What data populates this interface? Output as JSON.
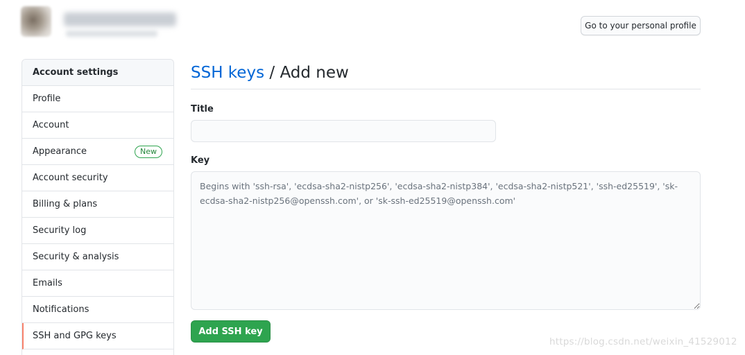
{
  "header": {
    "user_name": "",
    "user_subtitle": "",
    "profile_button_label": "Go to your personal profile"
  },
  "sidebar": {
    "heading": "Account settings",
    "items": [
      {
        "label": "Profile"
      },
      {
        "label": "Account"
      },
      {
        "label": "Appearance",
        "badge": "New"
      },
      {
        "label": "Account security"
      },
      {
        "label": "Billing & plans"
      },
      {
        "label": "Security log"
      },
      {
        "label": "Security & analysis"
      },
      {
        "label": "Emails"
      },
      {
        "label": "Notifications"
      },
      {
        "label": "SSH and GPG keys",
        "active": true
      }
    ],
    "active_accent": "#f9826c"
  },
  "main": {
    "breadcrumb_link": "SSH keys",
    "breadcrumb_separator": " / ",
    "breadcrumb_current": "Add new",
    "title_label": "Title",
    "title_value": "",
    "key_label": "Key",
    "key_value": "",
    "key_placeholder": "Begins with 'ssh-rsa', 'ecdsa-sha2-nistp256', 'ecdsa-sha2-nistp384', 'ecdsa-sha2-nistp521', 'ssh-ed25519', 'sk-ecdsa-sha2-nistp256@openssh.com', or 'sk-ssh-ed25519@openssh.com'",
    "submit_label": "Add SSH key"
  },
  "colors": {
    "link": "#0366d6",
    "primary_button": "#2ea44f",
    "border": "#e1e4e8"
  },
  "watermark": "https://blog.csdn.net/weixin_41529012"
}
